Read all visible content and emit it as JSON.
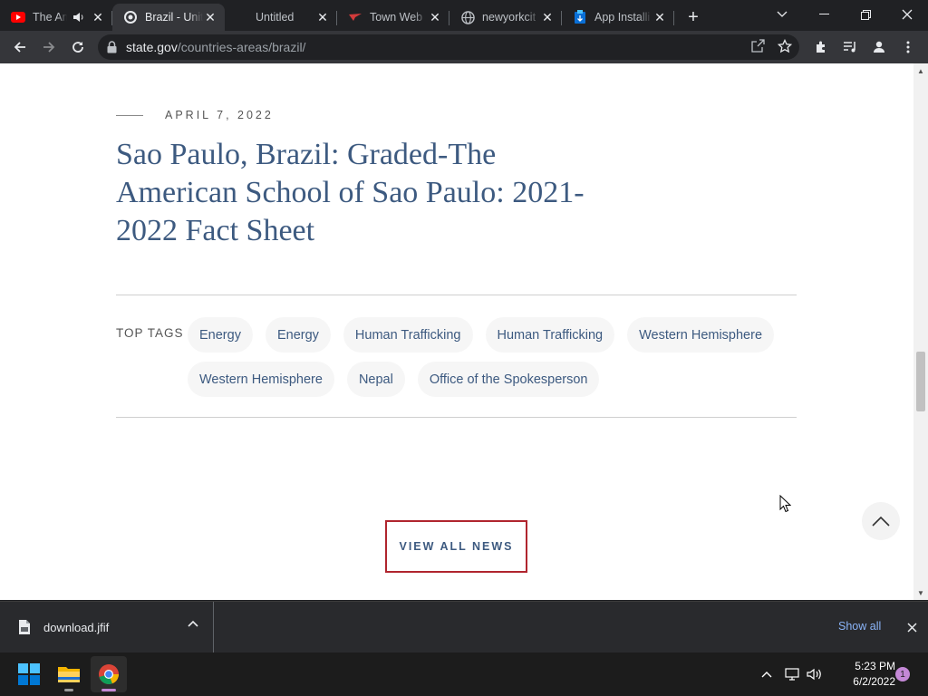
{
  "browser": {
    "tabs": [
      {
        "title": "The Am",
        "favicon": "youtube-icon",
        "audio": true,
        "active": false
      },
      {
        "title": "Brazil - Unit",
        "favicon": "state-dept-seal-icon",
        "audio": false,
        "active": true
      },
      {
        "title": "Untitled",
        "favicon": "",
        "audio": false,
        "active": false
      },
      {
        "title": "Town Web",
        "favicon": "bird-icon",
        "audio": false,
        "active": false
      },
      {
        "title": "newyorkcit",
        "favicon": "globe-icon",
        "audio": false,
        "active": false
      },
      {
        "title": "App Installi",
        "favicon": "app-installer-icon",
        "audio": false,
        "active": false
      }
    ],
    "url": {
      "host": "state.gov",
      "path": "/countries-areas/brazil/"
    }
  },
  "article": {
    "date": "APRIL 7, 2022",
    "title": "Sao Paulo, Brazil: Graded-The American School of Sao Paulo: 2021-2022 Fact Sheet"
  },
  "tags": {
    "label": "TOP TAGS",
    "items": [
      "Energy",
      "Energy",
      "Human Trafficking",
      "Human Trafficking",
      "Western Hemisphere",
      "Western Hemisphere",
      "Nepal",
      "Office of the Spokesperson"
    ]
  },
  "view_all_label": "VIEW ALL NEWS",
  "downloads": {
    "filename": "download.jfif",
    "show_all": "Show all"
  },
  "taskbar": {
    "time": "5:23 PM",
    "date": "6/2/2022",
    "notifications": "1"
  },
  "colors": {
    "link": "#3d5a80",
    "button_border": "#b0252e",
    "chrome_dark": "#202124"
  }
}
